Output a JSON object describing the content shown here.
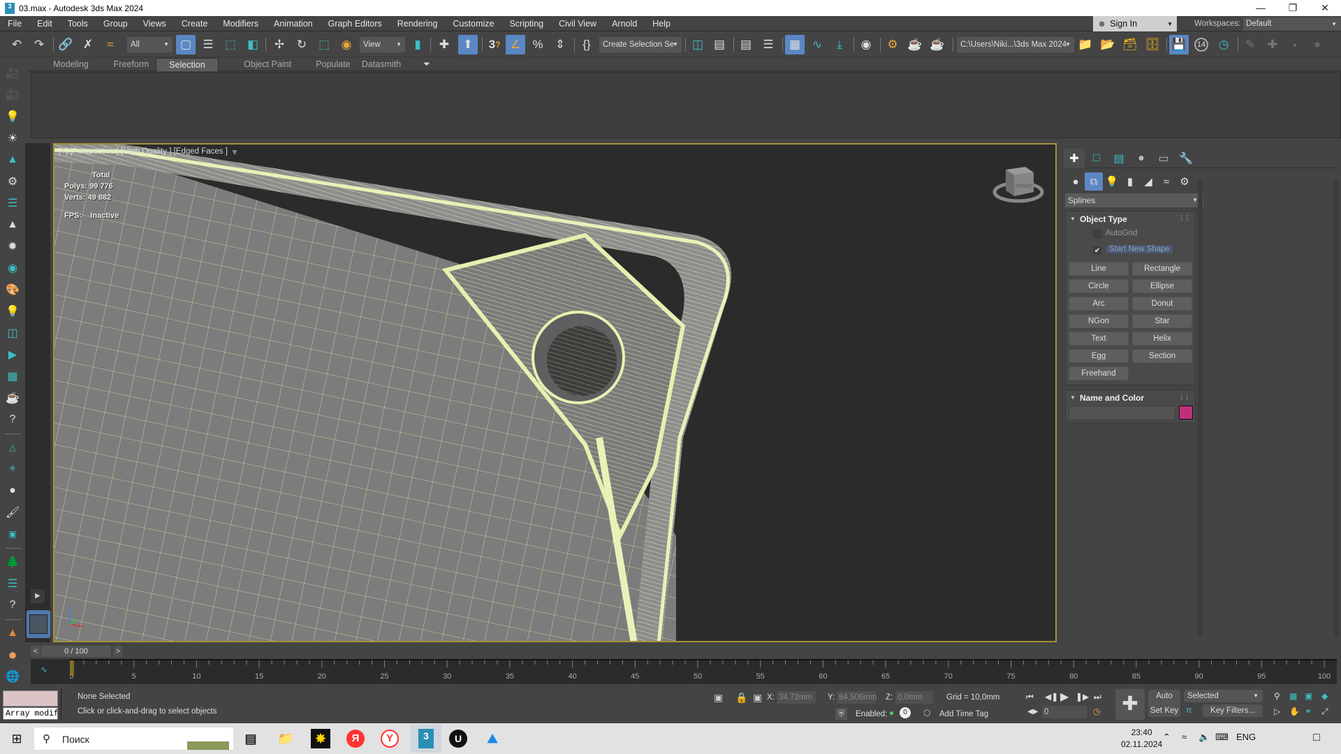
{
  "window": {
    "title": "03.max - Autodesk 3ds Max 2024",
    "app_icon": "3",
    "controls": [
      "minimize",
      "restore",
      "close"
    ]
  },
  "menubar": {
    "items": [
      "File",
      "Edit",
      "Tools",
      "Group",
      "Views",
      "Create",
      "Modifiers",
      "Animation",
      "Graph Editors",
      "Rendering",
      "Customize",
      "Scripting",
      "Civil View",
      "Arnold",
      "Help"
    ],
    "sign_in": "Sign In",
    "workspaces_label": "Workspaces:",
    "workspace_value": "Default"
  },
  "toolbar": {
    "selection_filter": "All",
    "reference_coord": "View",
    "named_selection_placeholder": "Create Selection Se",
    "project_path": "C:\\Users\\Niki...\\3ds Max 2024",
    "snap_angle_label": "3",
    "autobackup_count": "14",
    "icons": [
      "undo-icon",
      "redo-icon",
      "link-icon",
      "unlink-icon",
      "bind-spacewarp-icon",
      "select-object-icon",
      "select-by-name-icon",
      "rectangular-selection-icon",
      "window-crossing-icon",
      "move-icon",
      "rotate-icon",
      "scale-icon",
      "placement-icon",
      "use-pivot-icon",
      "transform-toggle-icon",
      "keyboard-shortcut-override-icon",
      "snaps-toggle-icon",
      "angle-snap-icon",
      "percent-snap-icon",
      "spinner-snap-icon",
      "edit-named-selection-icon",
      "mirror-icon",
      "align-icon",
      "scene-explorer-icon",
      "layer-explorer-icon",
      "toggle-ribbon-icon",
      "curve-editor-icon",
      "schematic-view-icon",
      "material-editor-icon",
      "render-setup-icon",
      "rendered-frame-icon",
      "render-icon",
      "arnold-render-icon"
    ]
  },
  "ribbon": {
    "tabs": [
      "Modeling",
      "Freeform",
      "Selection",
      "Object Paint",
      "Populate",
      "Datasmith"
    ],
    "active_tab": "Selection"
  },
  "viewport": {
    "label": "[+] [Perspective ] [High Quality ] [Edged Faces ]",
    "stats": {
      "header": "Total",
      "polys_label": "Polys:",
      "polys_value": "99 776",
      "verts_label": "Verts:",
      "verts_value": "49 882",
      "fps_label": "FPS:",
      "fps_value": "Inactive"
    },
    "viewcube_label": "FRONT"
  },
  "command_panel": {
    "tabs": [
      "create",
      "modify",
      "hierarchy",
      "motion",
      "display",
      "utilities"
    ],
    "categories": [
      "geometry",
      "shapes",
      "lights",
      "cameras",
      "helpers",
      "space-warps",
      "systems"
    ],
    "active_category": "shapes",
    "subcategory": "Splines",
    "object_type": {
      "title": "Object Type",
      "autogrid_label": "AutoGrid",
      "autogrid_checked": false,
      "start_new_shape_label": "Start New Shape",
      "start_new_shape_checked": true,
      "buttons": [
        "Line",
        "Rectangle",
        "Circle",
        "Ellipse",
        "Arc",
        "Donut",
        "NGon",
        "Star",
        "Text",
        "Helix",
        "Egg",
        "Section",
        "Freehand"
      ]
    },
    "name_and_color": {
      "title": "Name and Color",
      "name_value": "",
      "color": "#c0307a"
    }
  },
  "timeline": {
    "current": "0 / 100",
    "prev": "<",
    "next": ">",
    "ticks": [
      "0",
      "5",
      "10",
      "15",
      "20",
      "25",
      "30",
      "35",
      "40",
      "45",
      "50",
      "55",
      "60",
      "65",
      "70",
      "75",
      "80",
      "85",
      "90",
      "95",
      "100"
    ],
    "range_start": 0,
    "range_end": 100,
    "current_frame": 0
  },
  "status": {
    "maxscript_output": "Array modifi",
    "selection": "None Selected",
    "prompt": "Click or click-and-drag to select objects",
    "x_label": "X:",
    "x_value": "34,72mm",
    "y_label": "Y:",
    "y_value": "84,506mm",
    "z_label": "Z:",
    "z_value": "0,0mm",
    "grid": "Grid = 10,0mm",
    "enabled_label": "Enabled:",
    "enabled_count": "0",
    "add_time_tag": "Add Time Tag",
    "frame_value": "0",
    "auto_key": "Auto Key",
    "set_key": "Set Key",
    "key_mode": "Selected",
    "key_filters": "Key Filters..."
  },
  "taskbar": {
    "search_placeholder": "Поиск",
    "apps": [
      "task-view",
      "file-explorer",
      "app-sun",
      "yandex",
      "yandex-browser",
      "3ds-max",
      "unreal-engine",
      "photos"
    ],
    "language": "ENG",
    "time": "23:40",
    "date": "02.11.2024"
  }
}
